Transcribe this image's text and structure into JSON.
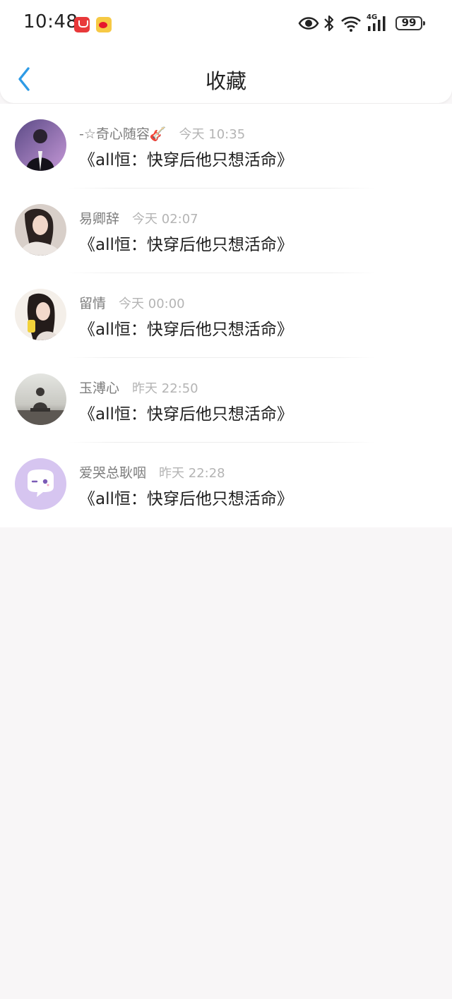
{
  "status_bar": {
    "time": "10:48",
    "network_label": "4G",
    "battery_level": "99"
  },
  "header": {
    "title": "收藏"
  },
  "favorites": [
    {
      "user_name": "-☆奇心随容🎸",
      "time": "今天 10:35",
      "title": "《all恒：快穿后他只想活命》"
    },
    {
      "user_name": "易卿辞",
      "time": "今天 02:07",
      "title": "《all恒：快穿后他只想活命》"
    },
    {
      "user_name": "留情",
      "time": "今天 00:00",
      "title": "《all恒：快穿后他只想活命》"
    },
    {
      "user_name": "玉溥心",
      "time": "昨天 22:50",
      "title": "《all恒：快穿后他只想活命》"
    },
    {
      "user_name": "爱哭总耿咽",
      "time": "昨天 22:28",
      "title": "《all恒：快穿后他只想活命》"
    }
  ]
}
